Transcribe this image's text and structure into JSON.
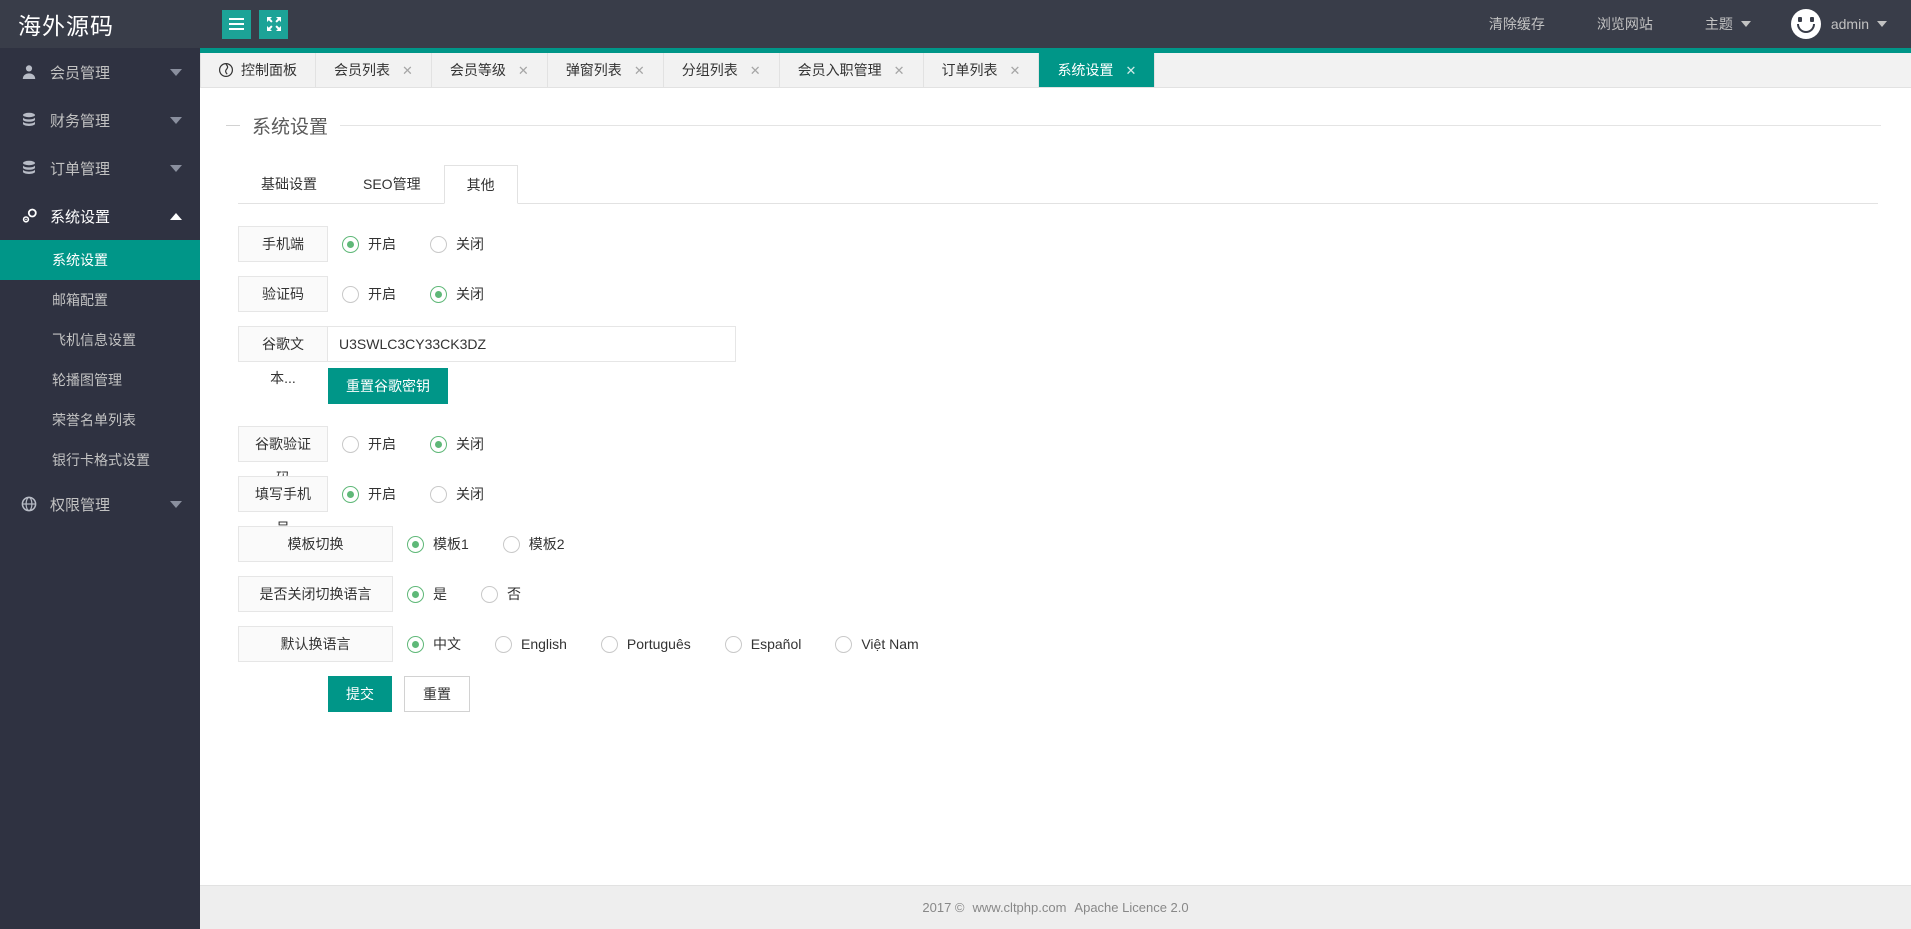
{
  "header": {
    "brand": "海外源码",
    "menu_toggle_icon": "hamburger-icon",
    "fullscreen_icon": "fullscreen-icon",
    "actions": [
      {
        "label": "清除缓存",
        "name": "clear-cache"
      },
      {
        "label": "浏览网站",
        "name": "visit-site"
      },
      {
        "label": "主题",
        "name": "theme",
        "has_caret": true
      }
    ],
    "user": {
      "name": "admin",
      "avatar_icon": "smiley-avatar-icon"
    }
  },
  "sidebar": {
    "groups": [
      {
        "label": "会员管理",
        "icon": "user-icon",
        "expanded": false
      },
      {
        "label": "财务管理",
        "icon": "database-icon",
        "expanded": false
      },
      {
        "label": "订单管理",
        "icon": "database-icon",
        "expanded": false
      },
      {
        "label": "系统设置",
        "icon": "gear-icon",
        "expanded": true
      }
    ],
    "sub_items": [
      {
        "label": "系统设置",
        "active": true
      },
      {
        "label": "邮箱配置",
        "active": false
      },
      {
        "label": "飞机信息设置",
        "active": false
      },
      {
        "label": "轮播图管理",
        "active": false
      },
      {
        "label": "荣誉名单列表",
        "active": false
      },
      {
        "label": "银行卡格式设置",
        "active": false
      }
    ],
    "last_group": {
      "label": "权限管理",
      "icon": "globe-icon",
      "expanded": false
    }
  },
  "tabs": [
    {
      "label": "控制面板",
      "icon": "home-icon",
      "closable": false,
      "active": false
    },
    {
      "label": "会员列表",
      "closable": true,
      "active": false
    },
    {
      "label": "会员等级",
      "closable": true,
      "active": false
    },
    {
      "label": "弹窗列表",
      "closable": true,
      "active": false
    },
    {
      "label": "分组列表",
      "closable": true,
      "active": false
    },
    {
      "label": "会员入职管理",
      "closable": true,
      "active": false
    },
    {
      "label": "订单列表",
      "closable": true,
      "active": false
    },
    {
      "label": "系统设置",
      "closable": true,
      "active": true
    }
  ],
  "tab_close_glyph": "✕",
  "page": {
    "title": "系统设置",
    "inner_tabs": [
      {
        "label": "基础设置",
        "active": false
      },
      {
        "label": "SEO管理",
        "active": false
      },
      {
        "label": "其他",
        "active": true
      }
    ]
  },
  "form": {
    "rows": [
      {
        "name": "mobile-terminal",
        "label": "手机端",
        "label_width": "w90",
        "type": "radio",
        "options": [
          {
            "label": "开启",
            "selected": true
          },
          {
            "label": "关闭",
            "selected": false
          }
        ]
      },
      {
        "name": "captcha",
        "label": "验证码",
        "label_width": "w90",
        "type": "radio",
        "options": [
          {
            "label": "开启",
            "selected": false
          },
          {
            "label": "关闭",
            "selected": true
          }
        ]
      },
      {
        "name": "google-secret",
        "label": "谷歌文本...",
        "label_width": "w90",
        "type": "text",
        "value": "U3SWLC3CY33CK3DZ",
        "placeholder": "",
        "action_button": "重置谷歌密钥"
      },
      {
        "name": "google-captcha",
        "label": "谷歌验证码",
        "label_width": "w90",
        "type": "radio",
        "options": [
          {
            "label": "开启",
            "selected": false
          },
          {
            "label": "关闭",
            "selected": true
          }
        ]
      },
      {
        "name": "fill-phone-number",
        "label": "填写手机号",
        "label_width": "w90",
        "type": "radio",
        "options": [
          {
            "label": "开启",
            "selected": true
          },
          {
            "label": "关闭",
            "selected": false
          }
        ]
      },
      {
        "name": "template-switch",
        "label": "模板切换",
        "label_width": "w155",
        "type": "radio",
        "options": [
          {
            "label": "模板1",
            "selected": true
          },
          {
            "label": "模板2",
            "selected": false
          }
        ]
      },
      {
        "name": "disable-language-switch",
        "label": "是否关闭切换语言",
        "label_width": "w155",
        "type": "radio",
        "options": [
          {
            "label": "是",
            "selected": true
          },
          {
            "label": "否",
            "selected": false
          }
        ]
      },
      {
        "name": "default-language",
        "label": "默认换语言",
        "label_width": "w155",
        "type": "radio",
        "options": [
          {
            "label": "中文",
            "selected": true
          },
          {
            "label": "English",
            "selected": false
          },
          {
            "label": "Português",
            "selected": false
          },
          {
            "label": "Español",
            "selected": false
          },
          {
            "label": "Việt Nam",
            "selected": false
          }
        ]
      }
    ],
    "submit_label": "提交",
    "reset_label": "重置"
  },
  "footer": {
    "year": "2017 ©",
    "site": "www.cltphp.com",
    "licence": "Apache Licence 2.0"
  },
  "colors": {
    "accent": "#009688",
    "header_bg": "#393D49",
    "sidebar_bg": "#2F3241",
    "radio_green": "#5FB878"
  }
}
